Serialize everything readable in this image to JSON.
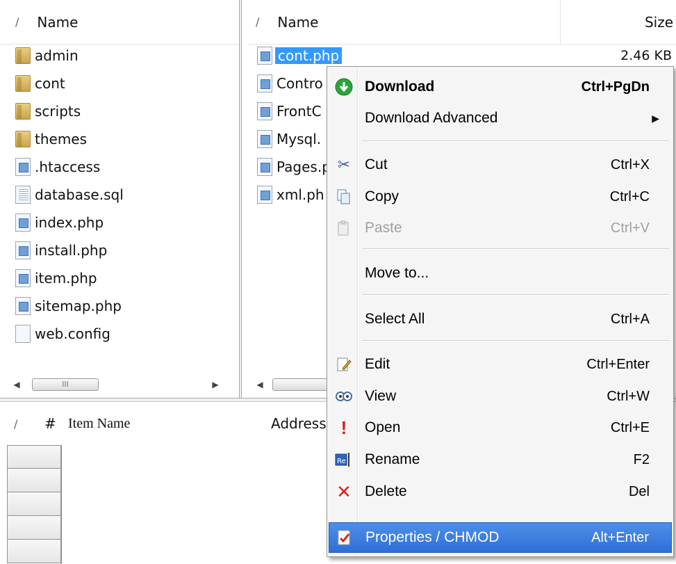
{
  "left_pane": {
    "header": {
      "slash": "/",
      "name": "Name"
    },
    "items": [
      {
        "name": "admin",
        "type": "folder"
      },
      {
        "name": "cont",
        "type": "folder"
      },
      {
        "name": "scripts",
        "type": "folder"
      },
      {
        "name": "themes",
        "type": "folder"
      },
      {
        "name": ".htaccess",
        "type": "file"
      },
      {
        "name": "database.sql",
        "type": "sql"
      },
      {
        "name": "index.php",
        "type": "file"
      },
      {
        "name": "install.php",
        "type": "file"
      },
      {
        "name": "item.php",
        "type": "file"
      },
      {
        "name": "sitemap.php",
        "type": "file"
      },
      {
        "name": "web.config",
        "type": "cfg"
      }
    ],
    "scroll_thumb": "III"
  },
  "right_pane": {
    "header": {
      "slash": "/",
      "name": "Name",
      "size": "Size"
    },
    "items": [
      {
        "name": "cont.php",
        "size": "2.46 KB",
        "selected": true
      },
      {
        "name": "Contro",
        "size": ""
      },
      {
        "name": "FrontC",
        "size": ""
      },
      {
        "name": "Mysql.",
        "size": ""
      },
      {
        "name": "Pages.p",
        "size": ""
      },
      {
        "name": "xml.ph",
        "size": ""
      }
    ]
  },
  "queue": {
    "header": {
      "slash": "/",
      "hash": "#",
      "item_name": "Item Name",
      "address": "Address"
    }
  },
  "context_menu": {
    "download": {
      "label": "Download",
      "shortcut": "Ctrl+PgDn",
      "icon": "download-arrow-icon"
    },
    "download_advanced": {
      "label": "Download Advanced",
      "shortcut": ""
    },
    "cut": {
      "label": "Cut",
      "shortcut": "Ctrl+X",
      "icon": "scissors-icon"
    },
    "copy": {
      "label": "Copy",
      "shortcut": "Ctrl+C",
      "icon": "copy-icon"
    },
    "paste": {
      "label": "Paste",
      "shortcut": "Ctrl+V",
      "icon": "paste-icon"
    },
    "move_to": {
      "label": "Move to...",
      "shortcut": ""
    },
    "select_all": {
      "label": "Select All",
      "shortcut": "Ctrl+A"
    },
    "edit": {
      "label": "Edit",
      "shortcut": "Ctrl+Enter",
      "icon": "edit-icon"
    },
    "view": {
      "label": "View",
      "shortcut": "Ctrl+W",
      "icon": "view-icon"
    },
    "open": {
      "label": "Open",
      "shortcut": "Ctrl+E",
      "icon": "exclamation-icon"
    },
    "rename": {
      "label": "Rename",
      "shortcut": "F2",
      "icon": "rename-icon"
    },
    "delete": {
      "label": "Delete",
      "shortcut": "Del",
      "icon": "delete-x-icon"
    },
    "properties": {
      "label": "Properties / CHMOD",
      "shortcut": "Alt+Enter",
      "icon": "properties-icon"
    }
  },
  "colors": {
    "selection": "#3399ff",
    "menu_highlight": "#2f6fd6",
    "menu_bg": "#f5f5f5"
  }
}
